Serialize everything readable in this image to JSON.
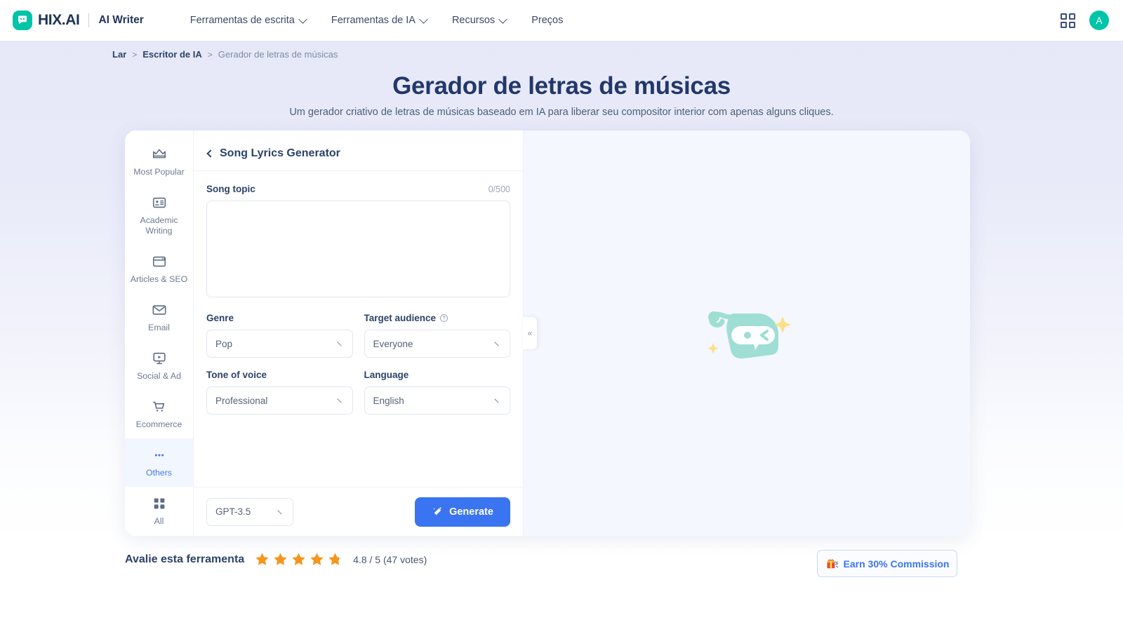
{
  "header": {
    "brand_name": "HIX.AI",
    "brand_sub": "AI Writer",
    "nav": [
      {
        "label": "Ferramentas de escrita",
        "has_dropdown": true
      },
      {
        "label": "Ferramentas de IA",
        "has_dropdown": true
      },
      {
        "label": "Recursos",
        "has_dropdown": true
      },
      {
        "label": "Preços",
        "has_dropdown": false
      }
    ],
    "avatar_initial": "A"
  },
  "breadcrumb": {
    "home": "Lar",
    "sep": ">",
    "section": "Escritor de IA",
    "current": "Gerador de letras de músicas"
  },
  "page": {
    "title": "Gerador de letras de músicas",
    "subtitle": "Um gerador criativo de letras de músicas baseado em IA para liberar seu compositor interior com apenas alguns cliques."
  },
  "sidebar": {
    "items": [
      {
        "label": "Most Popular",
        "icon": "crown-icon",
        "active": false
      },
      {
        "label": "Academic Writing",
        "icon": "id-card-icon",
        "active": false
      },
      {
        "label": "Articles & SEO",
        "icon": "browser-window-icon",
        "active": false
      },
      {
        "label": "Email",
        "icon": "envelope-icon",
        "active": false
      },
      {
        "label": "Social & Ad",
        "icon": "monitor-play-icon",
        "active": false
      },
      {
        "label": "Ecommerce",
        "icon": "shopping-cart-icon",
        "active": false
      },
      {
        "label": "Others",
        "icon": "ellipsis-icon",
        "active": true
      },
      {
        "label": "All",
        "icon": "grid-icon",
        "active": false
      }
    ]
  },
  "form": {
    "title": "Song Lyrics Generator",
    "back_icon": "chevron-left-icon",
    "song_topic": {
      "label": "Song topic",
      "counter": "0/500",
      "value": "",
      "placeholder": ""
    },
    "fields": [
      {
        "label": "Genre",
        "value": "Pop",
        "info": false
      },
      {
        "label": "Target audience",
        "value": "Everyone",
        "info": true
      },
      {
        "label": "Tone of voice",
        "value": "Professional",
        "info": false
      },
      {
        "label": "Language",
        "value": "English",
        "info": false
      }
    ],
    "model": {
      "value": "GPT-3.5"
    },
    "generate": {
      "label": "Generate",
      "icon": "magic-wand-icon"
    },
    "collapse_handle": "«"
  },
  "output": {
    "watermark_icon": "hix-mascot-logo"
  },
  "footer": {
    "rate_label": "Avalie esta ferramenta",
    "rating_value": "4.8 / 5 (47 votes)",
    "stars_filled": 4.8,
    "stars_total": 5,
    "commission_label": "Earn 30% Commission",
    "commission_icon": "gift-icon"
  },
  "colors": {
    "brand_teal": "#00c4a7",
    "accent_blue": "#3a74f0",
    "title_navy": "#22386a",
    "star_orange": "#f7941d",
    "panel_bg": "#f4f7fd"
  }
}
